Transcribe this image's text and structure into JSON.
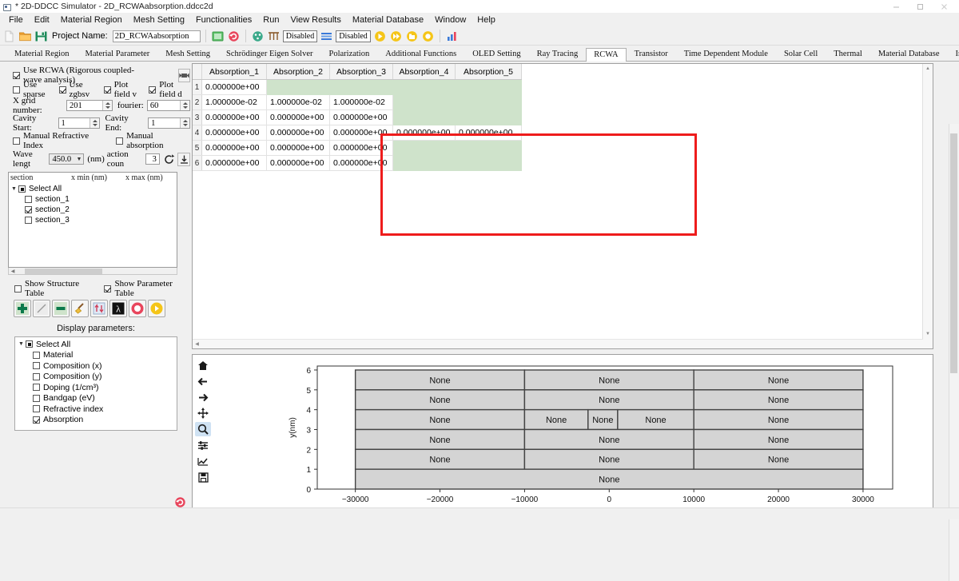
{
  "window": {
    "title": "* 2D-DDCC Simulator - 2D_RCWAabsorption.ddcc2d",
    "minimize": "—",
    "maximize": "❐",
    "close": "✕"
  },
  "menubar": {
    "items": [
      "File",
      "Edit",
      "Material Region",
      "Mesh Setting",
      "Functionalities",
      "Run",
      "View Results",
      "Material Database",
      "Window",
      "Help"
    ]
  },
  "toolbar": {
    "project_label": "Project Name:",
    "project_value": "2D_RCWAabsorption",
    "disabled_1": "Disabled",
    "disabled_2": "Disabled",
    "icons": [
      "new-file-icon",
      "open-folder-icon",
      "save-icon",
      "screenshot-icon",
      "refresh-icon",
      "mesh-icon",
      "grid-icon",
      "layers-icon",
      "run-icon",
      "run-all-icon",
      "run-batch-icon",
      "stop-icon",
      "chart-icon"
    ]
  },
  "tabs": {
    "items": [
      "Material Region",
      "Material Parameter",
      "Mesh Setting",
      "Schrödinger Eigen Solver",
      "Polarization",
      "Additional Functions",
      "OLED Setting",
      "Ray Tracing",
      "RCWA",
      "Transistor",
      "Time Dependent Module",
      "Solar Cell",
      "Thermal",
      "Material Database",
      "Input Editor"
    ],
    "active": "RCWA"
  },
  "sidebar": {
    "use_rcwa": {
      "label": "Use RCWA (Rigorous coupled-wave analysis)",
      "checked": true
    },
    "toggle_icon": "expand-collapse-icon",
    "options_row": [
      {
        "label": "Use sparse",
        "checked": false
      },
      {
        "label": "Use zgbsv",
        "checked": true
      },
      {
        "label": "Plot field v",
        "checked": true
      },
      {
        "label": "Plot field d",
        "checked": true
      }
    ],
    "x_grid": {
      "label": "X grid number:",
      "value": "201"
    },
    "fourier": {
      "label": "fourier:",
      "value": "60"
    },
    "cavity_start": {
      "label": "Cavity Start:",
      "value": "1"
    },
    "cavity_end": {
      "label": "Cavity End:",
      "value": "1"
    },
    "manual_refractive": {
      "label": "Manual Refractive Index",
      "checked": false
    },
    "manual_absorption": {
      "label": "Manual absorption",
      "checked": false
    },
    "wavelength": {
      "label": "Wave lengt",
      "value": "450.0",
      "unit": "(nm)"
    },
    "action_count": {
      "label": "action coun",
      "value": "3"
    },
    "reset_icon": "reset-arrow-icon",
    "download_icon": "download-icon",
    "section_table": {
      "columns": [
        "section",
        "x min (nm)",
        "x max (nm)"
      ],
      "root": {
        "label": "Select All",
        "state": "partial"
      },
      "rows": [
        {
          "label": "section_1",
          "checked": false
        },
        {
          "label": "section_2",
          "checked": true
        },
        {
          "label": "section_3",
          "checked": false
        }
      ]
    },
    "show_structure_table": {
      "label": "Show Structure Table",
      "checked": false
    },
    "show_parameter_table": {
      "label": "Show Parameter Table",
      "checked": true
    },
    "action_icons": [
      "add-icon",
      "edit-icon",
      "remove-icon",
      "clear-broom-icon",
      "sort-updown-icon",
      "lambda-icon",
      "stop-circle-icon",
      "play-circle-icon"
    ],
    "display_parameters_title": "Display parameters:",
    "display_parameters": {
      "root": {
        "label": "Select All",
        "state": "partial"
      },
      "items": [
        {
          "label": "Material",
          "checked": false
        },
        {
          "label": "Composition (x)",
          "checked": false
        },
        {
          "label": "Composition (y)",
          "checked": false
        },
        {
          "label": "Doping (1/cm³)",
          "checked": false
        },
        {
          "label": "Bandgap (eV)",
          "checked": false
        },
        {
          "label": "Refractive index",
          "checked": false
        },
        {
          "label": "Absorption",
          "checked": true
        }
      ]
    }
  },
  "data_table": {
    "columns": [
      "Absorption_1",
      "Absorption_2",
      "Absorption_3",
      "Absorption_4",
      "Absorption_5"
    ],
    "row_numbers": [
      "1",
      "2",
      "3",
      "4",
      "5",
      "6"
    ],
    "rows": [
      [
        "0.000000e+00",
        "",
        "",
        "",
        ""
      ],
      [
        "1.000000e-02",
        "1.000000e-02",
        "1.000000e-02",
        "",
        ""
      ],
      [
        "0.000000e+00",
        "0.000000e+00",
        "0.000000e+00",
        "",
        ""
      ],
      [
        "0.000000e+00",
        "0.000000e+00",
        "0.000000e+00",
        "0.000000e+00",
        "0.000000e+00"
      ],
      [
        "0.000000e+00",
        "0.000000e+00",
        "0.000000e+00",
        "",
        ""
      ],
      [
        "0.000000e+00",
        "0.000000e+00",
        "0.000000e+00",
        "",
        ""
      ]
    ],
    "highlight_color": "#ee1c1c",
    "empty_cell_color": "#cfe3cb"
  },
  "plot_toolbar": {
    "buttons": [
      "home-icon",
      "back-arrow-icon",
      "forward-arrow-icon",
      "pan-move-icon",
      "zoom-magnifier-icon",
      "configure-subplots-icon",
      "edit-curve-icon",
      "save-disk-icon"
    ],
    "selected": "zoom-magnifier-icon"
  },
  "chart_data": {
    "type": "table",
    "title": "",
    "xlabel": "",
    "ylabel": "y(nm)",
    "xlim": [
      -34500,
      33500
    ],
    "ylim": [
      0,
      6.2
    ],
    "xticks": [
      -30000,
      -20000,
      -10000,
      0,
      10000,
      20000,
      30000
    ],
    "xticklabels": [
      "−30000",
      "−20000",
      "−10000",
      "0",
      "10000",
      "20000",
      "30000"
    ],
    "yticks": [
      0,
      1,
      2,
      3,
      4,
      5,
      6
    ],
    "yticklabels": [
      "0",
      "1",
      "2",
      "3",
      "4",
      "5",
      "6"
    ],
    "grid": false,
    "legend": null,
    "cell_fill": "#d4d4d4",
    "cell_label": "None",
    "regions": [
      {
        "y0": 5,
        "y1": 6,
        "cells": [
          {
            "x0": -30000,
            "x1": -10000,
            "label": "None"
          },
          {
            "x0": -10000,
            "x1": 10000,
            "label": "None"
          },
          {
            "x0": 10000,
            "x1": 30000,
            "label": "None"
          }
        ]
      },
      {
        "y0": 4,
        "y1": 5,
        "cells": [
          {
            "x0": -30000,
            "x1": -10000,
            "label": "None"
          },
          {
            "x0": -10000,
            "x1": 10000,
            "label": "None"
          },
          {
            "x0": 10000,
            "x1": 30000,
            "label": "None"
          }
        ]
      },
      {
        "y0": 3,
        "y1": 4,
        "cells": [
          {
            "x0": -30000,
            "x1": -10000,
            "label": "None"
          },
          {
            "x0": -10000,
            "x1": -2500,
            "label": "None"
          },
          {
            "x0": -2500,
            "x1": 1000,
            "label": "None"
          },
          {
            "x0": 1000,
            "x1": 10000,
            "label": "None"
          },
          {
            "x0": 10000,
            "x1": 30000,
            "label": "None"
          }
        ]
      },
      {
        "y0": 2,
        "y1": 3,
        "cells": [
          {
            "x0": -30000,
            "x1": -10000,
            "label": "None"
          },
          {
            "x0": -10000,
            "x1": 10000,
            "label": "None"
          },
          {
            "x0": 10000,
            "x1": 30000,
            "label": "None"
          }
        ]
      },
      {
        "y0": 1,
        "y1": 2,
        "cells": [
          {
            "x0": -30000,
            "x1": -10000,
            "label": "None"
          },
          {
            "x0": -10000,
            "x1": 10000,
            "label": "None"
          },
          {
            "x0": 10000,
            "x1": 30000,
            "label": "None"
          }
        ]
      },
      {
        "y0": 0,
        "y1": 1,
        "cells": [
          {
            "x0": -30000,
            "x1": 30000,
            "label": "None"
          }
        ]
      }
    ]
  }
}
